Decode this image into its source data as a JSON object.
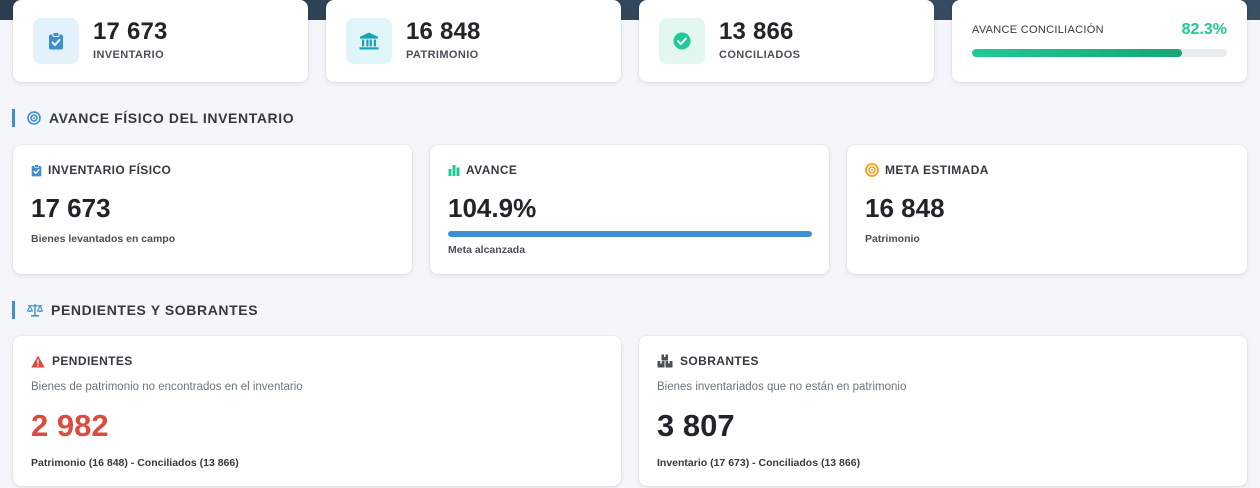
{
  "kpis": [
    {
      "value": "17 673",
      "label": "INVENTARIO",
      "icon": "clipboard-check-icon",
      "color": "#3d8fd1",
      "bg": "#e3f1fb"
    },
    {
      "value": "16 848",
      "label": "PATRIMONIO",
      "icon": "bank-icon",
      "color": "#17a2b8",
      "bg": "#e0f5f8"
    },
    {
      "value": "13 866",
      "label": "CONCILIADOS",
      "icon": "check-circle-icon",
      "color": "#20c997",
      "bg": "#e2f7ef"
    }
  ],
  "conciliacion": {
    "label": "AVANCE CONCILIACIÓN",
    "percent_text": "82.3%",
    "percent": 82.3,
    "color": "#20c997"
  },
  "section_avance": {
    "title": "AVANCE FÍSICO DEL INVENTARIO",
    "icon": "target-icon"
  },
  "inventario_fisico": {
    "title": "INVENTARIO FÍSICO",
    "value": "17 673",
    "caption": "Bienes levantados en campo",
    "icon": "clipboard-check-icon"
  },
  "avance": {
    "title": "AVANCE",
    "value": "104.9%",
    "percent": 104.9,
    "caption": "Meta alcanzada",
    "icon": "bar-chart-icon",
    "color": "#3d8fd1"
  },
  "meta": {
    "title": "META ESTIMADA",
    "value": "16 848",
    "caption": "Patrimonio",
    "icon": "bullseye-icon"
  },
  "section_pendientes": {
    "title": "PENDIENTES Y SOBRANTES",
    "icon": "balance-scale-icon"
  },
  "pendientes": {
    "title": "PENDIENTES",
    "description": "Bienes de patrimonio no encontrados en el inventario",
    "value": "2 982",
    "formula": "Patrimonio (16 848) - Conciliados (13 866)",
    "icon": "warning-icon",
    "color": "#dc4b3e"
  },
  "sobrantes": {
    "title": "SOBRANTES",
    "description": "Bienes inventariados que no están en patrimonio",
    "value": "3 807",
    "formula": "Inventario (17 673) - Conciliados (13 866)",
    "icon": "boxes-icon",
    "color": "#212529"
  }
}
